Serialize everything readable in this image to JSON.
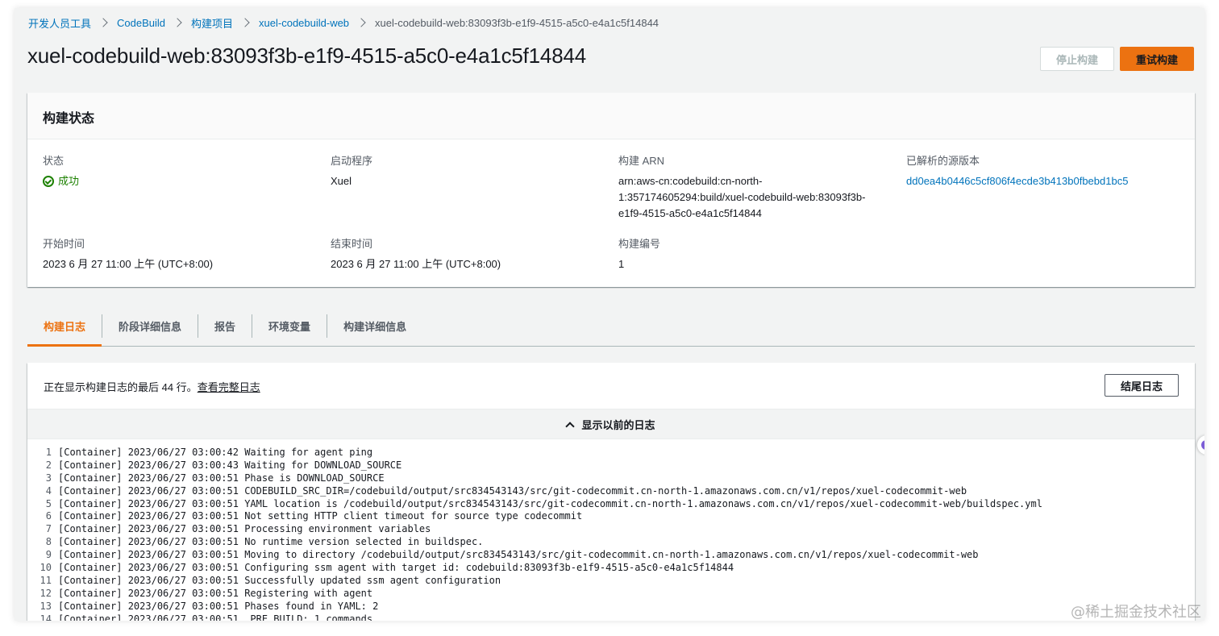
{
  "breadcrumb": {
    "items": [
      "开发人员工具",
      "CodeBuild",
      "构建项目",
      "xuel-codebuild-web"
    ],
    "current": "xuel-codebuild-web:83093f3b-e1f9-4515-a5c0-e4a1c5f14844"
  },
  "header": {
    "title": "xuel-codebuild-web:83093f3b-e1f9-4515-a5c0-e4a1c5f14844",
    "stop_label": "停止构建",
    "retry_label": "重试构建"
  },
  "build_status": {
    "title": "构建状态",
    "status_label": "状态",
    "status_value": "成功",
    "initiator_label": "启动程序",
    "initiator_value": "Xuel",
    "arn_label": "构建 ARN",
    "arn_lines": [
      "arn:aws-cn:codebuild:cn-north-",
      "1:357174605294:build/xuel-codebuild-web:83093f3b-",
      "e1f9-4515-a5c0-e4a1c5f14844"
    ],
    "source_version_label": "已解析的源版本",
    "source_version_value": "dd0ea4b0446c5cf806f4ecde3b413b0fbebd1bc5",
    "start_label": "开始时间",
    "start_value": "2023 6 月 27 11:00 上午 (UTC+8:00)",
    "end_label": "结束时间",
    "end_value": "2023 6 月 27 11:00 上午 (UTC+8:00)",
    "number_label": "构建编号",
    "number_value": "1"
  },
  "tabs": [
    "构建日志",
    "阶段详细信息",
    "报告",
    "环境变量",
    "构建详细信息"
  ],
  "logs": {
    "info_prefix": "正在显示构建日志的最后 44 行。",
    "info_link": "查看完整日志",
    "tail_label": "结尾日志",
    "show_previous": "显示以前的日志",
    "lines": [
      "[Container] 2023/06/27 03:00:42 Waiting for agent ping",
      "[Container] 2023/06/27 03:00:43 Waiting for DOWNLOAD_SOURCE",
      "[Container] 2023/06/27 03:00:51 Phase is DOWNLOAD_SOURCE",
      "[Container] 2023/06/27 03:00:51 CODEBUILD_SRC_DIR=/codebuild/output/src834543143/src/git-codecommit.cn-north-1.amazonaws.com.cn/v1/repos/xuel-codecommit-web",
      "[Container] 2023/06/27 03:00:51 YAML location is /codebuild/output/src834543143/src/git-codecommit.cn-north-1.amazonaws.com.cn/v1/repos/xuel-codecommit-web/buildspec.yml",
      "[Container] 2023/06/27 03:00:51 Not setting HTTP client timeout for source type codecommit",
      "[Container] 2023/06/27 03:00:51 Processing environment variables",
      "[Container] 2023/06/27 03:00:51 No runtime version selected in buildspec.",
      "[Container] 2023/06/27 03:00:51 Moving to directory /codebuild/output/src834543143/src/git-codecommit.cn-north-1.amazonaws.com.cn/v1/repos/xuel-codecommit-web",
      "[Container] 2023/06/27 03:00:51 Configuring ssm agent with target id: codebuild:83093f3b-e1f9-4515-a5c0-e4a1c5f14844",
      "[Container] 2023/06/27 03:00:51 Successfully updated ssm agent configuration",
      "[Container] 2023/06/27 03:00:51 Registering with agent",
      "[Container] 2023/06/27 03:00:51 Phases found in YAML: 2",
      "[Container] 2023/06/27 03:00:51  PRE_BUILD: 1 commands"
    ]
  },
  "watermark": "@稀土掘金技术社区",
  "colors": {
    "link": "#0073bb",
    "accent": "#ec7211",
    "success": "#1d8102"
  }
}
